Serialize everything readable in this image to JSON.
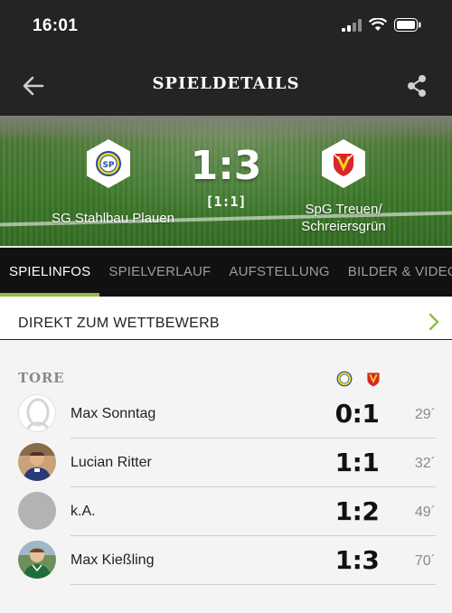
{
  "status_bar": {
    "time": "16:01"
  },
  "header": {
    "title": "SPIELDETAILS"
  },
  "match": {
    "home_team": "SG Stahlbau Plauen",
    "away_team_line1": "SpG Treuen/",
    "away_team_line2": "Schreiersgrün",
    "score": "1:3",
    "halftime": "[1:1]"
  },
  "tabs": [
    {
      "label": "SPIELINFOS",
      "active": true
    },
    {
      "label": "SPIELVERLAUF",
      "active": false
    },
    {
      "label": "AUFSTELLUNG",
      "active": false
    },
    {
      "label": "BILDER & VIDEOS",
      "active": false
    }
  ],
  "competition_link": {
    "label": "DIREKT ZUM WETTBEWERB"
  },
  "goals": {
    "title": "TORE",
    "items": [
      {
        "player": "Max Sonntag",
        "score": "0:1",
        "minute": "29´",
        "avatar": "placeholder-silhouette"
      },
      {
        "player": "Lucian Ritter",
        "score": "1:1",
        "minute": "32´",
        "avatar": "player-photo"
      },
      {
        "player": "k.A.",
        "score": "1:2",
        "minute": "49´",
        "avatar": "grey-placeholder"
      },
      {
        "player": "Max Kießling",
        "score": "1:3",
        "minute": "70´",
        "avatar": "player-photo"
      }
    ]
  },
  "colors": {
    "accent": "#8cbf3f",
    "header_bg": "#242424",
    "tab_bg": "#111111"
  }
}
